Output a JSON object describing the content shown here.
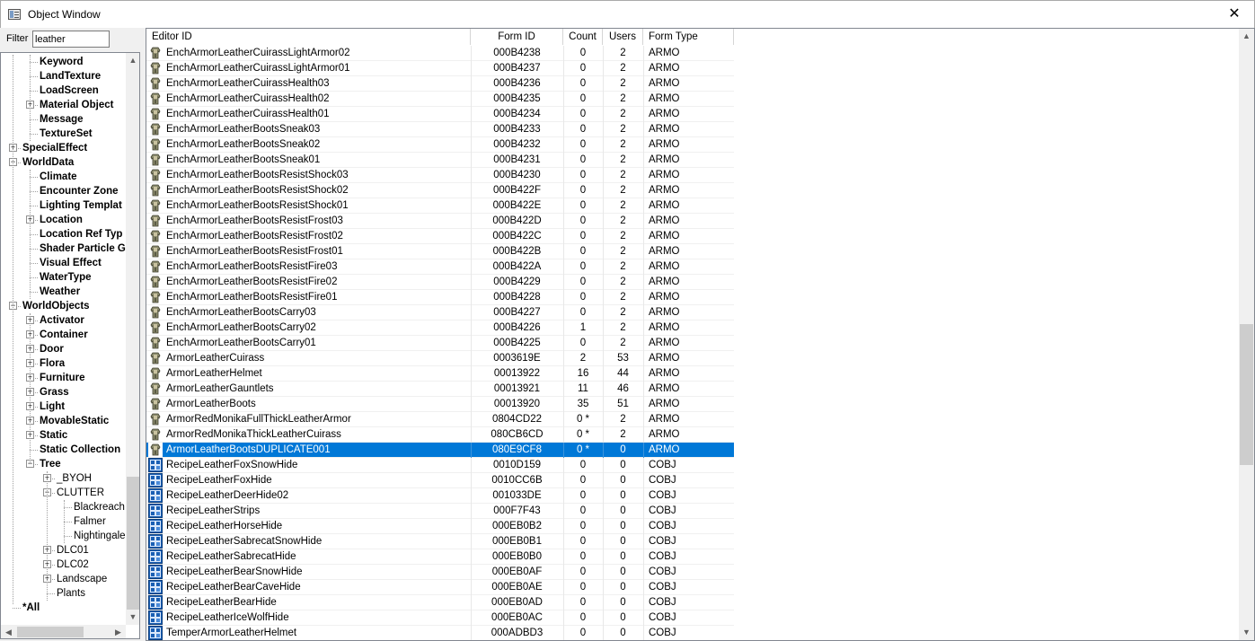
{
  "window": {
    "title": "Object Window",
    "close_label": "✕"
  },
  "filter": {
    "label": "Filter",
    "value": "leather"
  },
  "tree": {
    "nodes": [
      {
        "label": "Keyword",
        "level": 1,
        "bold": true,
        "expander": ""
      },
      {
        "label": "LandTexture",
        "level": 1,
        "bold": true,
        "expander": ""
      },
      {
        "label": "LoadScreen",
        "level": 1,
        "bold": true,
        "expander": ""
      },
      {
        "label": "Material Object",
        "level": 1,
        "bold": true,
        "expander": "+"
      },
      {
        "label": "Message",
        "level": 1,
        "bold": true,
        "expander": ""
      },
      {
        "label": "TextureSet",
        "level": 1,
        "bold": true,
        "expander": ""
      },
      {
        "label": "SpecialEffect",
        "level": 0,
        "bold": true,
        "expander": "+"
      },
      {
        "label": "WorldData",
        "level": 0,
        "bold": true,
        "expander": "-"
      },
      {
        "label": "Climate",
        "level": 1,
        "bold": true,
        "expander": ""
      },
      {
        "label": "Encounter Zone",
        "level": 1,
        "bold": true,
        "expander": ""
      },
      {
        "label": "Lighting Templat",
        "level": 1,
        "bold": true,
        "expander": ""
      },
      {
        "label": "Location",
        "level": 1,
        "bold": true,
        "expander": "+"
      },
      {
        "label": "Location Ref Typ",
        "level": 1,
        "bold": true,
        "expander": ""
      },
      {
        "label": "Shader Particle G",
        "level": 1,
        "bold": true,
        "expander": ""
      },
      {
        "label": "Visual Effect",
        "level": 1,
        "bold": true,
        "expander": ""
      },
      {
        "label": "WaterType",
        "level": 1,
        "bold": true,
        "expander": ""
      },
      {
        "label": "Weather",
        "level": 1,
        "bold": true,
        "expander": ""
      },
      {
        "label": "WorldObjects",
        "level": 0,
        "bold": true,
        "expander": "-"
      },
      {
        "label": "Activator",
        "level": 1,
        "bold": true,
        "expander": "+"
      },
      {
        "label": "Container",
        "level": 1,
        "bold": true,
        "expander": "+"
      },
      {
        "label": "Door",
        "level": 1,
        "bold": true,
        "expander": "+"
      },
      {
        "label": "Flora",
        "level": 1,
        "bold": true,
        "expander": "+"
      },
      {
        "label": "Furniture",
        "level": 1,
        "bold": true,
        "expander": "+"
      },
      {
        "label": "Grass",
        "level": 1,
        "bold": true,
        "expander": "+"
      },
      {
        "label": "Light",
        "level": 1,
        "bold": true,
        "expander": "+"
      },
      {
        "label": "MovableStatic",
        "level": 1,
        "bold": true,
        "expander": "+"
      },
      {
        "label": "Static",
        "level": 1,
        "bold": true,
        "expander": "+"
      },
      {
        "label": "Static Collection",
        "level": 1,
        "bold": true,
        "expander": ""
      },
      {
        "label": "Tree",
        "level": 1,
        "bold": true,
        "expander": "-"
      },
      {
        "label": "_BYOH",
        "level": 2,
        "bold": false,
        "expander": "+"
      },
      {
        "label": "CLUTTER",
        "level": 2,
        "bold": false,
        "expander": "-"
      },
      {
        "label": "Blackreach",
        "level": 3,
        "bold": false,
        "expander": ""
      },
      {
        "label": "Falmer",
        "level": 3,
        "bold": false,
        "expander": ""
      },
      {
        "label": "Nightingale",
        "level": 3,
        "bold": false,
        "expander": ""
      },
      {
        "label": "DLC01",
        "level": 2,
        "bold": false,
        "expander": "+"
      },
      {
        "label": "DLC02",
        "level": 2,
        "bold": false,
        "expander": "+"
      },
      {
        "label": "Landscape",
        "level": 2,
        "bold": false,
        "expander": "+"
      },
      {
        "label": "Plants",
        "level": 2,
        "bold": false,
        "expander": ""
      },
      {
        "label": "*All",
        "level": 0,
        "bold": true,
        "expander": ""
      }
    ]
  },
  "list": {
    "columns": {
      "editor_id": "Editor ID",
      "form_id": "Form ID",
      "count": "Count",
      "users": "Users",
      "form_type": "Form Type"
    },
    "rows": [
      {
        "icon": "armor-icon",
        "editor_id": "EnchArmorLeatherCuirassLightArmor02",
        "form_id": "000B4238",
        "count": "0",
        "users": "2",
        "form_type": "ARMO"
      },
      {
        "icon": "armor-icon",
        "editor_id": "EnchArmorLeatherCuirassLightArmor01",
        "form_id": "000B4237",
        "count": "0",
        "users": "2",
        "form_type": "ARMO"
      },
      {
        "icon": "armor-icon",
        "editor_id": "EnchArmorLeatherCuirassHealth03",
        "form_id": "000B4236",
        "count": "0",
        "users": "2",
        "form_type": "ARMO"
      },
      {
        "icon": "armor-icon",
        "editor_id": "EnchArmorLeatherCuirassHealth02",
        "form_id": "000B4235",
        "count": "0",
        "users": "2",
        "form_type": "ARMO"
      },
      {
        "icon": "armor-icon",
        "editor_id": "EnchArmorLeatherCuirassHealth01",
        "form_id": "000B4234",
        "count": "0",
        "users": "2",
        "form_type": "ARMO"
      },
      {
        "icon": "armor-icon",
        "editor_id": "EnchArmorLeatherBootsSneak03",
        "form_id": "000B4233",
        "count": "0",
        "users": "2",
        "form_type": "ARMO"
      },
      {
        "icon": "armor-icon",
        "editor_id": "EnchArmorLeatherBootsSneak02",
        "form_id": "000B4232",
        "count": "0",
        "users": "2",
        "form_type": "ARMO"
      },
      {
        "icon": "armor-icon",
        "editor_id": "EnchArmorLeatherBootsSneak01",
        "form_id": "000B4231",
        "count": "0",
        "users": "2",
        "form_type": "ARMO"
      },
      {
        "icon": "armor-icon",
        "editor_id": "EnchArmorLeatherBootsResistShock03",
        "form_id": "000B4230",
        "count": "0",
        "users": "2",
        "form_type": "ARMO"
      },
      {
        "icon": "armor-icon",
        "editor_id": "EnchArmorLeatherBootsResistShock02",
        "form_id": "000B422F",
        "count": "0",
        "users": "2",
        "form_type": "ARMO"
      },
      {
        "icon": "armor-icon",
        "editor_id": "EnchArmorLeatherBootsResistShock01",
        "form_id": "000B422E",
        "count": "0",
        "users": "2",
        "form_type": "ARMO"
      },
      {
        "icon": "armor-icon",
        "editor_id": "EnchArmorLeatherBootsResistFrost03",
        "form_id": "000B422D",
        "count": "0",
        "users": "2",
        "form_type": "ARMO"
      },
      {
        "icon": "armor-icon",
        "editor_id": "EnchArmorLeatherBootsResistFrost02",
        "form_id": "000B422C",
        "count": "0",
        "users": "2",
        "form_type": "ARMO"
      },
      {
        "icon": "armor-icon",
        "editor_id": "EnchArmorLeatherBootsResistFrost01",
        "form_id": "000B422B",
        "count": "0",
        "users": "2",
        "form_type": "ARMO"
      },
      {
        "icon": "armor-icon",
        "editor_id": "EnchArmorLeatherBootsResistFire03",
        "form_id": "000B422A",
        "count": "0",
        "users": "2",
        "form_type": "ARMO"
      },
      {
        "icon": "armor-icon",
        "editor_id": "EnchArmorLeatherBootsResistFire02",
        "form_id": "000B4229",
        "count": "0",
        "users": "2",
        "form_type": "ARMO"
      },
      {
        "icon": "armor-icon",
        "editor_id": "EnchArmorLeatherBootsResistFire01",
        "form_id": "000B4228",
        "count": "0",
        "users": "2",
        "form_type": "ARMO"
      },
      {
        "icon": "armor-icon",
        "editor_id": "EnchArmorLeatherBootsCarry03",
        "form_id": "000B4227",
        "count": "0",
        "users": "2",
        "form_type": "ARMO"
      },
      {
        "icon": "armor-icon",
        "editor_id": "EnchArmorLeatherBootsCarry02",
        "form_id": "000B4226",
        "count": "1",
        "users": "2",
        "form_type": "ARMO"
      },
      {
        "icon": "armor-icon",
        "editor_id": "EnchArmorLeatherBootsCarry01",
        "form_id": "000B4225",
        "count": "0",
        "users": "2",
        "form_type": "ARMO"
      },
      {
        "icon": "armor-icon",
        "editor_id": "ArmorLeatherCuirass",
        "form_id": "0003619E",
        "count": "2",
        "users": "53",
        "form_type": "ARMO"
      },
      {
        "icon": "armor-icon",
        "editor_id": "ArmorLeatherHelmet",
        "form_id": "00013922",
        "count": "16",
        "users": "44",
        "form_type": "ARMO"
      },
      {
        "icon": "armor-icon",
        "editor_id": "ArmorLeatherGauntlets",
        "form_id": "00013921",
        "count": "11",
        "users": "46",
        "form_type": "ARMO"
      },
      {
        "icon": "armor-icon",
        "editor_id": "ArmorLeatherBoots",
        "form_id": "00013920",
        "count": "35",
        "users": "51",
        "form_type": "ARMO"
      },
      {
        "icon": "armor-icon",
        "editor_id": "ArmorRedMonikaFullThickLeatherArmor",
        "form_id": "0804CD22",
        "count": "0 *",
        "users": "2",
        "form_type": "ARMO"
      },
      {
        "icon": "armor-icon",
        "editor_id": "ArmorRedMonikaThickLeatherCuirass",
        "form_id": "080CB6CD",
        "count": "0 *",
        "users": "2",
        "form_type": "ARMO"
      },
      {
        "icon": "armor-icon",
        "editor_id": "ArmorLeatherBootsDUPLICATE001",
        "form_id": "080E9CF8",
        "count": "0 *",
        "users": "0",
        "form_type": "ARMO",
        "selected": true
      },
      {
        "icon": "recipe-icon",
        "editor_id": "RecipeLeatherFoxSnowHide",
        "form_id": "0010D159",
        "count": "0",
        "users": "0",
        "form_type": "COBJ"
      },
      {
        "icon": "recipe-icon",
        "editor_id": "RecipeLeatherFoxHide",
        "form_id": "0010CC6B",
        "count": "0",
        "users": "0",
        "form_type": "COBJ"
      },
      {
        "icon": "recipe-icon",
        "editor_id": "RecipeLeatherDeerHide02",
        "form_id": "001033DE",
        "count": "0",
        "users": "0",
        "form_type": "COBJ"
      },
      {
        "icon": "recipe-icon",
        "editor_id": "RecipeLeatherStrips",
        "form_id": "000F7F43",
        "count": "0",
        "users": "0",
        "form_type": "COBJ"
      },
      {
        "icon": "recipe-icon",
        "editor_id": "RecipeLeatherHorseHide",
        "form_id": "000EB0B2",
        "count": "0",
        "users": "0",
        "form_type": "COBJ"
      },
      {
        "icon": "recipe-icon",
        "editor_id": "RecipeLeatherSabrecatSnowHide",
        "form_id": "000EB0B1",
        "count": "0",
        "users": "0",
        "form_type": "COBJ"
      },
      {
        "icon": "recipe-icon",
        "editor_id": "RecipeLeatherSabrecatHide",
        "form_id": "000EB0B0",
        "count": "0",
        "users": "0",
        "form_type": "COBJ"
      },
      {
        "icon": "recipe-icon",
        "editor_id": "RecipeLeatherBearSnowHide",
        "form_id": "000EB0AF",
        "count": "0",
        "users": "0",
        "form_type": "COBJ"
      },
      {
        "icon": "recipe-icon",
        "editor_id": "RecipeLeatherBearCaveHide",
        "form_id": "000EB0AE",
        "count": "0",
        "users": "0",
        "form_type": "COBJ"
      },
      {
        "icon": "recipe-icon",
        "editor_id": "RecipeLeatherBearHide",
        "form_id": "000EB0AD",
        "count": "0",
        "users": "0",
        "form_type": "COBJ"
      },
      {
        "icon": "recipe-icon",
        "editor_id": "RecipeLeatherIceWolfHide",
        "form_id": "000EB0AC",
        "count": "0",
        "users": "0",
        "form_type": "COBJ"
      },
      {
        "icon": "recipe-icon",
        "editor_id": "TemperArmorLeatherHelmet",
        "form_id": "000ADBD3",
        "count": "0",
        "users": "0",
        "form_type": "COBJ"
      }
    ]
  },
  "colors": {
    "selection": "#0078d7",
    "border": "#828790"
  }
}
